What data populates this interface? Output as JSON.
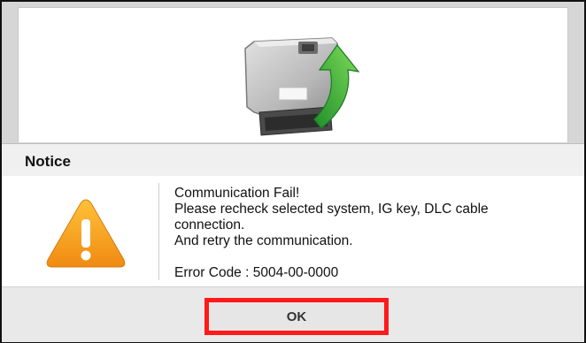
{
  "dialog": {
    "title": "Notice",
    "message_lines": [
      "Communication Fail!",
      "Please recheck selected system, IG key, DLC cable",
      "connection.",
      "And retry the communication."
    ],
    "error_code": "Error Code : 5004-00-0000",
    "ok_label": "OK",
    "icon": "warning-triangle-icon"
  },
  "graphic": {
    "icon": "ecu-module-icon",
    "arrow_icon": "green-curved-arrow-icon"
  },
  "colors": {
    "highlight": "#ff1a1a",
    "warning": "#f5a623",
    "arrow": "#3fb53a"
  }
}
